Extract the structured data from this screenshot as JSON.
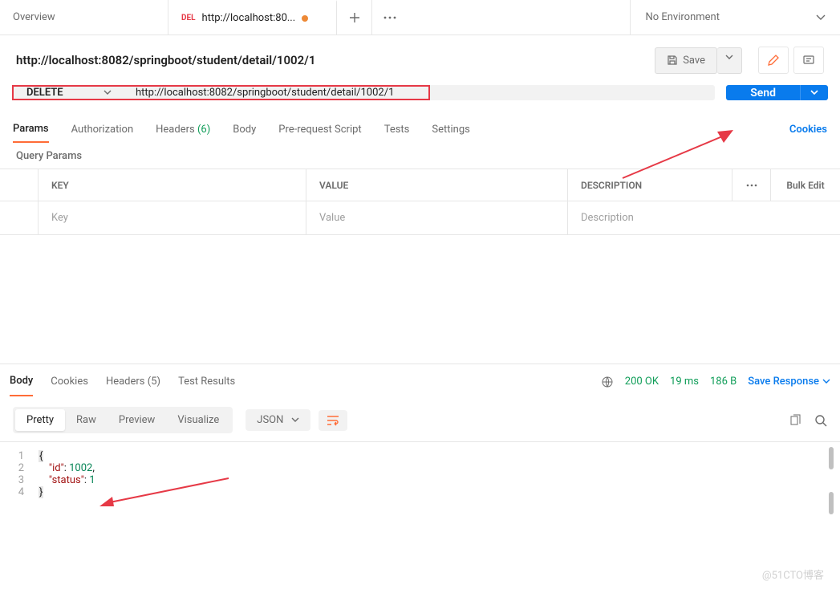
{
  "tabs": {
    "overview": "Overview",
    "req_method": "DEL",
    "req_title": "http://localhost:80..."
  },
  "environment": "No Environment",
  "title": "http://localhost:8082/springboot/student/detail/1002/1",
  "save_label": "Save",
  "request": {
    "method": "DELETE",
    "url": "http://localhost:8082/springboot/student/detail/1002/1",
    "send": "Send"
  },
  "req_tabs": {
    "params": "Params",
    "auth": "Authorization",
    "headers": "Headers",
    "headers_count": "(6)",
    "body": "Body",
    "prereq": "Pre-request Script",
    "tests": "Tests",
    "settings": "Settings",
    "cookies": "Cookies"
  },
  "qp_label": "Query Params",
  "params_head": {
    "key": "KEY",
    "value": "VALUE",
    "desc": "DESCRIPTION",
    "bulk": "Bulk Edit"
  },
  "params_ph": {
    "key": "Key",
    "value": "Value",
    "desc": "Description"
  },
  "resp_tabs": {
    "body": "Body",
    "cookies": "Cookies",
    "headers": "Headers",
    "headers_count": "(5)",
    "tests": "Test Results"
  },
  "status": {
    "code": "200 OK",
    "time": "19 ms",
    "size": "186 B",
    "save": "Save Response"
  },
  "view": {
    "pretty": "Pretty",
    "raw": "Raw",
    "preview": "Preview",
    "visualize": "Visualize",
    "lang": "JSON"
  },
  "code_lines": [
    {
      "n": "1",
      "brace": "{"
    },
    {
      "n": "2",
      "key": "\"id\"",
      "sep": ": ",
      "val": "1002",
      "comma": ","
    },
    {
      "n": "3",
      "key": "\"status\"",
      "sep": ": ",
      "val": "1"
    },
    {
      "n": "4",
      "brace": "}"
    }
  ],
  "watermark": "@51CTO博客"
}
